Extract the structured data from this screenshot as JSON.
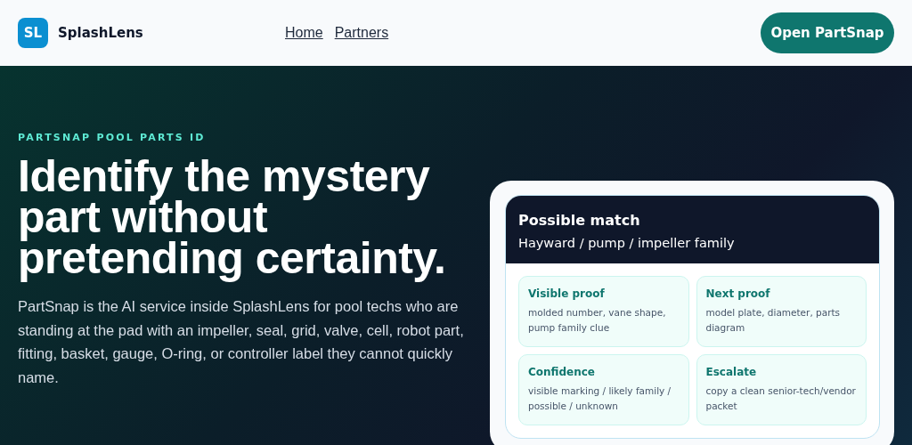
{
  "brand": {
    "logo": "SL",
    "name": "SplashLens"
  },
  "nav": [
    "Home",
    "Partners"
  ],
  "cta": "Open PartSnap",
  "hero": {
    "eyebrow": "PARTSNAP POOL PARTS ID",
    "heading": "Identify the mystery part without pretending certainty.",
    "body": "PartSnap is the AI service inside SplashLens for pool techs who are standing at the pad with an impeller, seal, grid, valve, cell, robot part, fitting, basket, gauge, O-ring, or controller label they cannot quickly name."
  },
  "match_card": {
    "title": "Possible match",
    "subtitle": "Hayward / pump / impeller family",
    "tiles": [
      {
        "title": "Visible proof",
        "text": "molded number, vane shape, pump family clue"
      },
      {
        "title": "Next proof",
        "text": "model plate, diameter, parts diagram"
      },
      {
        "title": "Confidence",
        "text": "visible marking / likely family / possible / unknown"
      },
      {
        "title": "Escalate",
        "text": "copy a clean senior-tech/vendor packet"
      }
    ]
  }
}
